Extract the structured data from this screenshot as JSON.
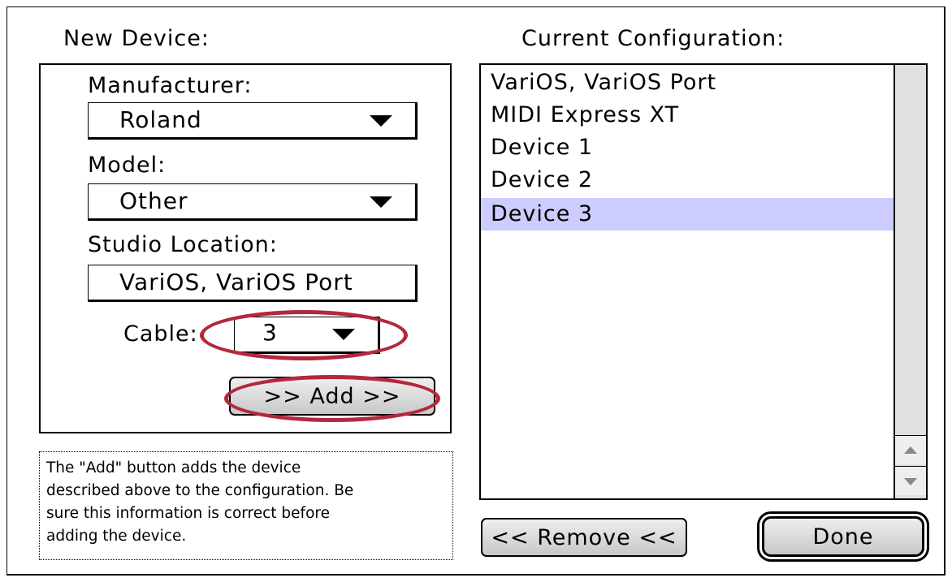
{
  "new_device": {
    "title": "New Device:",
    "manufacturer_label": "Manufacturer:",
    "manufacturer_value": "Roland",
    "model_label": "Model:",
    "model_value": "Other",
    "studio_location_label": "Studio Location:",
    "studio_location_value": "VariOS, VariOS Port",
    "cable_label": "Cable:",
    "cable_value": "3",
    "add_button": ">> Add >>"
  },
  "help_text": [
    "The \"Add\" button adds the device",
    "described above to the configuration.  Be",
    "sure this information is correct before",
    "adding the device."
  ],
  "current_configuration": {
    "title": "Current Configuration:",
    "items": [
      "VariOS, VariOS Port",
      "MIDI Express XT",
      "Device 1",
      "Device 2",
      "Device 3"
    ],
    "selected_index": 4
  },
  "buttons": {
    "remove": "<< Remove <<",
    "done": "Done"
  },
  "colors": {
    "selection": "#ccccff",
    "annotation_ring": "#b4283c"
  },
  "icons": {
    "popup_arrow": "triangle-down",
    "scroll_up": "triangle-up",
    "scroll_down": "triangle-down"
  }
}
